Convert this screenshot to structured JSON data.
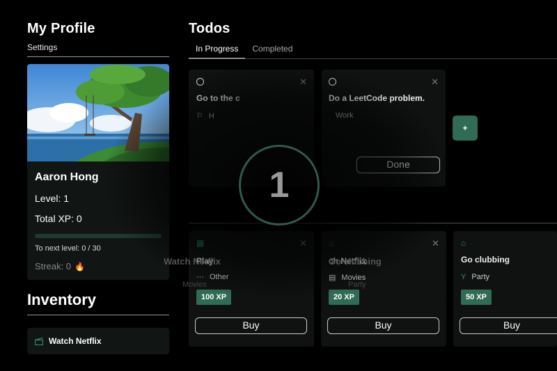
{
  "profile": {
    "title": "My Profile",
    "settings_label": "Settings",
    "name": "Aaron Hong",
    "level": "Level: 1",
    "total_xp": "Total XP: 0",
    "level_progress": 0,
    "to_next_level": "To next level: 0 / 30",
    "streak": "Streak: 0"
  },
  "inventory": {
    "title": "Inventory",
    "items": [
      {
        "label": "Watch Netflix",
        "icon": "clapperboard-icon"
      }
    ]
  },
  "todos": {
    "title": "Todos",
    "tabs": [
      {
        "label": "In Progress",
        "active": true
      },
      {
        "label": "Completed",
        "active": false
      }
    ],
    "cards": [
      {
        "title": "Go to the c",
        "tag": "H"
      },
      {
        "title": "Do a LeetCode problem.",
        "tag": "Work",
        "button": "Done"
      }
    ],
    "add_label": "+"
  },
  "shop": {
    "items": [
      {
        "title": "Play",
        "category": "Other",
        "xp": "100 XP",
        "button": "Buy",
        "icon": "calendar-icon"
      },
      {
        "title": "ch Netflix",
        "category": "Movies",
        "xp": "20 XP",
        "button": "Buy",
        "icon": "shop-icon"
      },
      {
        "title": "Go clubbing",
        "category": "Party",
        "xp": "50 XP",
        "button": "Buy",
        "icon": "store-icon"
      }
    ]
  },
  "overlay": {
    "countdown": "1",
    "ghost_items": [
      "Watch Netflix",
      "Movies",
      "Go clubbing",
      "Party"
    ]
  },
  "colors": {
    "accent": "#2f6b55",
    "background": "#000000",
    "card": "#0f1211"
  }
}
